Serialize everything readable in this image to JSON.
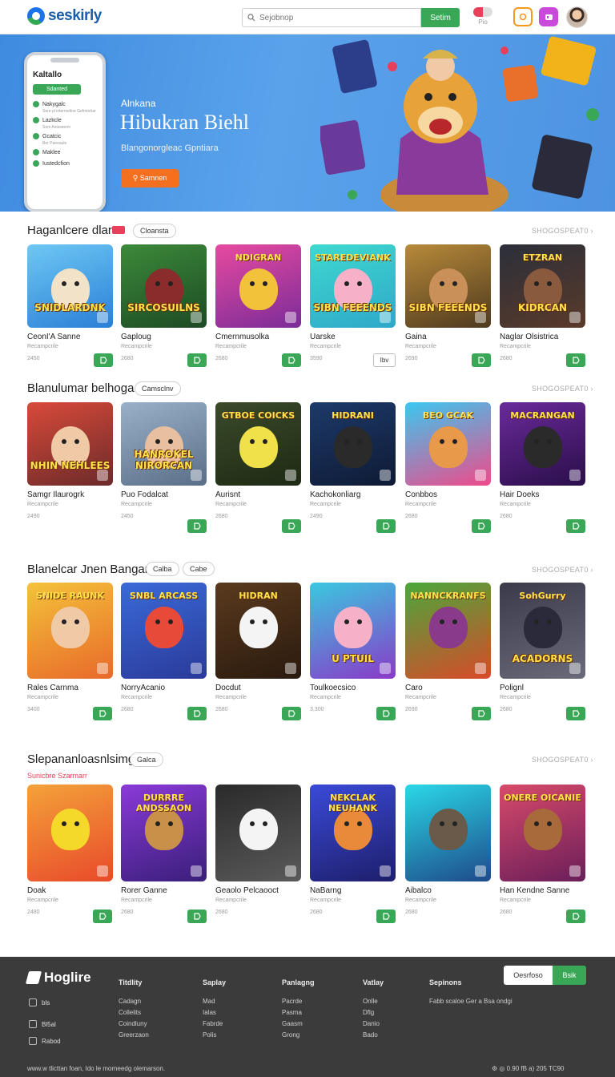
{
  "header": {
    "logo": "seskirly",
    "search_placeholder": "Sejobnop",
    "search_button": "Setim",
    "mini_label": "Pio"
  },
  "hero": {
    "phone": {
      "title": "Kaltallo",
      "button": "Sdanted",
      "rows": [
        {
          "label": "Nakygalc",
          "sub": "Sere pl intermeline Gefmortue"
        },
        {
          "label": "Lazkcle",
          "sub": "Som Aeisseerm"
        },
        {
          "label": "Gcatcic",
          "sub": "Ber Paeeaule"
        },
        {
          "label": "Maklee",
          "sub": ""
        },
        {
          "label": "Iustedcfion",
          "sub": ""
        }
      ]
    },
    "kicker": "Alnkana",
    "title": "Hibukran Biehl",
    "subtitle": "Blangonorgleac Gpntiara",
    "button": "Samnen"
  },
  "sections": [
    {
      "title": "Haganlcere dlart",
      "chips": [
        "Cloansta"
      ],
      "see_all": "SHOGOSPEAT0",
      "games": [
        {
          "name": "CeonI'A Sanne",
          "sub": "Recampcrile",
          "count": "2450",
          "button": "",
          "caption": "SNIDLARDNK",
          "top": "",
          "bg": "linear-gradient(160deg,#6ec8f4,#2a7fd6)",
          "fig": "#f2e2c8"
        },
        {
          "name": "Gaploug",
          "sub": "Recampcrile",
          "count": "2680",
          "button": "",
          "caption": "SIRCOSUILNS",
          "top": "",
          "bg": "linear-gradient(160deg,#3c8a3a,#1d4a24)",
          "fig": "#8a2c2c"
        },
        {
          "name": "Cmernmusolka",
          "sub": "Recampcrile",
          "count": "2680",
          "button": "",
          "caption": "",
          "top": "NDIGRAN",
          "bg": "linear-gradient(160deg,#e84aa0,#7a2c98)",
          "fig": "#f2c23a"
        },
        {
          "name": "Uarske",
          "sub": "Recampcrile",
          "count": "3590",
          "button": "Ibv",
          "caption": "SIBN FEEENDS",
          "top": "STAREDEVIANK",
          "bg": "linear-gradient(160deg,#3fd9d0,#2ea8c8)",
          "fig": "#f6b0c8"
        },
        {
          "name": "Gaina",
          "sub": "Recampcrile",
          "count": "2690",
          "button": "",
          "caption": "SIBN FEEENDS",
          "top": "",
          "bg": "linear-gradient(160deg,#b88a3a,#4e3a1e)",
          "fig": "#c9905a"
        },
        {
          "name": "Naglar Olsistrica",
          "sub": "Recampcrile",
          "count": "2680",
          "button": "",
          "caption": "KIDRCAN",
          "top": "ETZRAN",
          "bg": "linear-gradient(160deg,#2b2f3a,#5a3a2a)",
          "fig": "#8a5a3e"
        }
      ]
    },
    {
      "title": "Blanulumar belhoga",
      "chips": [
        "Camsclnv"
      ],
      "see_all": "SHOGOSPEAT0",
      "games": [
        {
          "name": "Samgr Ilaurogrk",
          "sub": "Recampcrile",
          "count": "2490",
          "button": "",
          "caption": "NHIN NEHLEES",
          "top": "",
          "bg": "linear-gradient(160deg,#d94a3a,#6b2a2a)",
          "fig": "#f0c9a6"
        },
        {
          "name": "Puo Fodalcat",
          "sub": "Recampcrile",
          "count": "2450",
          "button": "",
          "caption": "HANROKEL NIRORCAN",
          "top": "",
          "bg": "linear-gradient(160deg,#9ab0c8,#5a6e88)",
          "fig": "#e8c0a0"
        },
        {
          "name": "Aurisnt",
          "sub": "Recampcrile",
          "count": "2680",
          "button": "",
          "caption": "",
          "top": "GTBOE COICKS",
          "bg": "linear-gradient(160deg,#3a4a2a,#1e2a14)",
          "fig": "#f0e04a"
        },
        {
          "name": "Kachokonliarg",
          "sub": "Recampcrile",
          "count": "2490",
          "button": "",
          "caption": "",
          "top": "HIDRANI",
          "bg": "linear-gradient(160deg,#1d3a6a,#0e1a34)",
          "fig": "#2a2a2a"
        },
        {
          "name": "Conbbos",
          "sub": "Recampcrile",
          "count": "2680",
          "button": "",
          "caption": "",
          "top": "BEO GCAK",
          "bg": "linear-gradient(160deg,#3ac8f0,#f04a8a)",
          "fig": "#e89a4a"
        },
        {
          "name": "Hair Doeks",
          "sub": "Recampcrile",
          "count": "2680",
          "button": "",
          "caption": "",
          "top": "MACRANGAN",
          "bg": "linear-gradient(160deg,#6a2a9a,#2a0e4a)",
          "fig": "#2a2a2a"
        }
      ]
    },
    {
      "title": "Blanelcar Jnen Bangan",
      "chips": [
        "Calba",
        "Cabe"
      ],
      "see_all": "SHOGOSPEAT0",
      "games": [
        {
          "name": "Rales Carnma",
          "sub": "Recampcrile",
          "count": "3400",
          "button": "",
          "caption": "",
          "top": "SNIDE RAUNK",
          "bg": "linear-gradient(160deg,#f4c23a,#e86a2a)",
          "fig": "#f0c9a6"
        },
        {
          "name": "NorryAcanio",
          "sub": "Recampcrile",
          "count": "2680",
          "button": "",
          "caption": "",
          "top": "SNBL ARCASS",
          "bg": "linear-gradient(160deg,#3a6ad8,#2a3a9a)",
          "fig": "#e84a3a"
        },
        {
          "name": "Docdut",
          "sub": "Recampcrile",
          "count": "2680",
          "button": "",
          "caption": "",
          "top": "HIDRAN",
          "bg": "linear-gradient(160deg,#5a3a1e,#2a1a0e)",
          "fig": "#f4f4f4"
        },
        {
          "name": "Toulkoecsico",
          "sub": "Recampcrile",
          "count": "3,300",
          "button": "",
          "caption": "U PTUIL",
          "top": "",
          "bg": "linear-gradient(160deg,#3ac8e0,#8a3ac8)",
          "fig": "#f6b0c8"
        },
        {
          "name": "Caro",
          "sub": "Recampcrile",
          "count": "2690",
          "button": "",
          "caption": "",
          "top": "NANNCKRANFS",
          "bg": "linear-gradient(160deg,#4aa83a,#d84a2a)",
          "fig": "#8a3a8a"
        },
        {
          "name": "Polignl",
          "sub": "Recampcrile",
          "count": "2680",
          "button": "",
          "caption": "ACADORNS",
          "top": "SohGurry",
          "bg": "linear-gradient(160deg,#3a3a4a,#6a6a7a)",
          "fig": "#2a2a3a"
        }
      ]
    },
    {
      "title": "Slepananloasnlsimg",
      "chips": [
        "Galca"
      ],
      "see_all": "SHOGOSPEAT0",
      "promo": "Sunicbre Szarmarr",
      "games": [
        {
          "name": "Doak",
          "sub": "Recampcrile",
          "count": "2480",
          "button": "",
          "caption": "",
          "top": "",
          "bg": "linear-gradient(160deg,#f4a23a,#e84a2a)",
          "fig": "#f4d82a"
        },
        {
          "name": "Rorer Ganne",
          "sub": "Recampcrile",
          "count": "2680",
          "button": "",
          "caption": "",
          "top": "DURRRE ANDSSAON",
          "bg": "linear-gradient(160deg,#8a3ad8,#3a1e7a)",
          "fig": "#c9904a"
        },
        {
          "name": "Geaolo Pelcaooct",
          "sub": "Recampcrile",
          "count": "2680",
          "button": "",
          "caption": "",
          "top": "",
          "bg": "linear-gradient(160deg,#2a2a2a,#5a5a5a)",
          "fig": "#f4f4f4"
        },
        {
          "name": "NaBarng",
          "sub": "Recampcrile",
          "count": "2680",
          "button": "",
          "caption": "",
          "top": "NEKCLAK NEUHANK",
          "bg": "linear-gradient(160deg,#3a4ad8,#1e1e6a)",
          "fig": "#e88a3a"
        },
        {
          "name": "Aibalco",
          "sub": "Recampcrile",
          "count": "2680",
          "button": "",
          "caption": "",
          "top": "",
          "bg": "linear-gradient(160deg,#2ad8e8,#1e4a8a)",
          "fig": "#6a5a4a"
        },
        {
          "name": "Han Kendne Sanne",
          "sub": "Recampcrile",
          "count": "2680",
          "button": "",
          "caption": "",
          "top": "ONERE OICANIE",
          "bg": "linear-gradient(160deg,#d84a6a,#6a1e5a)",
          "fig": "#a86a3a"
        }
      ]
    }
  ],
  "footer": {
    "logo": "Hoglire",
    "side": [
      "bls",
      "Bl5al",
      "Rabod"
    ],
    "columns": [
      {
        "title": "Titdlity",
        "links": [
          "Cadagn",
          "Collelits",
          "Coindluny",
          "Greerzaon"
        ]
      },
      {
        "title": "Saplay",
        "links": [
          "Mad",
          "Ialas",
          "Fabrde",
          "Polis"
        ]
      },
      {
        "title": "Panlagng",
        "links": [
          "Pacrde",
          "Pasma",
          "Gaasm",
          "Grong"
        ]
      },
      {
        "title": "Vatlay",
        "links": [
          "Onlle",
          "Dflg",
          "Danio",
          "Bado"
        ]
      }
    ],
    "newsletter_title": "Sepinons",
    "newsletter_text": "Fabb scaloe Ger a Bsa ondgi",
    "subscribe_input": "Oesrfoso",
    "subscribe_button": "Bsik",
    "copyright": "www.w tlicttan foan, Ido le morneedg olemarson.",
    "right": "0.90 fB a) 205 TC90"
  }
}
